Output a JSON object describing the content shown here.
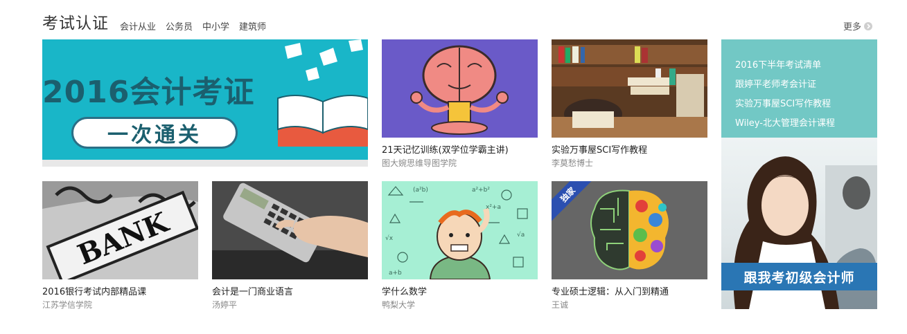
{
  "header": {
    "title": "考试认证",
    "tabs": [
      "会计从业",
      "公务员",
      "中小学",
      "建筑师"
    ],
    "more_label": "更多"
  },
  "banner": {
    "title": "2016会计考证",
    "subtitle": "一次通关"
  },
  "courses": [
    {
      "title": "21天记忆训练(双学位学霸主讲)",
      "teacher": "图大婉思维导图学院"
    },
    {
      "title": "实验万事屋SCI写作教程",
      "teacher": "李莫愁博士"
    },
    {
      "title": "2016银行考试内部精品课",
      "teacher": "江苏学信学院"
    },
    {
      "title": "会计是一门商业语言",
      "teacher": "汤婷平"
    },
    {
      "title": "学什么数学",
      "teacher": "鸭梨大学"
    },
    {
      "title": "专业硕士逻辑：从入门到精通",
      "teacher": "王诚",
      "badge": "独家"
    }
  ],
  "thumbs": {
    "bank_sign": "BANK"
  },
  "ad": {
    "links": [
      "2016下半年考试清单",
      "跟婷平老师考会计证",
      "实验万事屋SCI写作教程",
      "Wiley-北大管理会计课程"
    ],
    "caption": "跟我考初级会计师"
  },
  "colors": {
    "banner_bg": "#19b6c8",
    "ad_links_bg": "#72c8c5",
    "ad_caption_bg": "#2a76b4",
    "brain_bg": "#6a5ac8",
    "math_bg": "#a6efd4",
    "logic_bg": "#666666"
  }
}
